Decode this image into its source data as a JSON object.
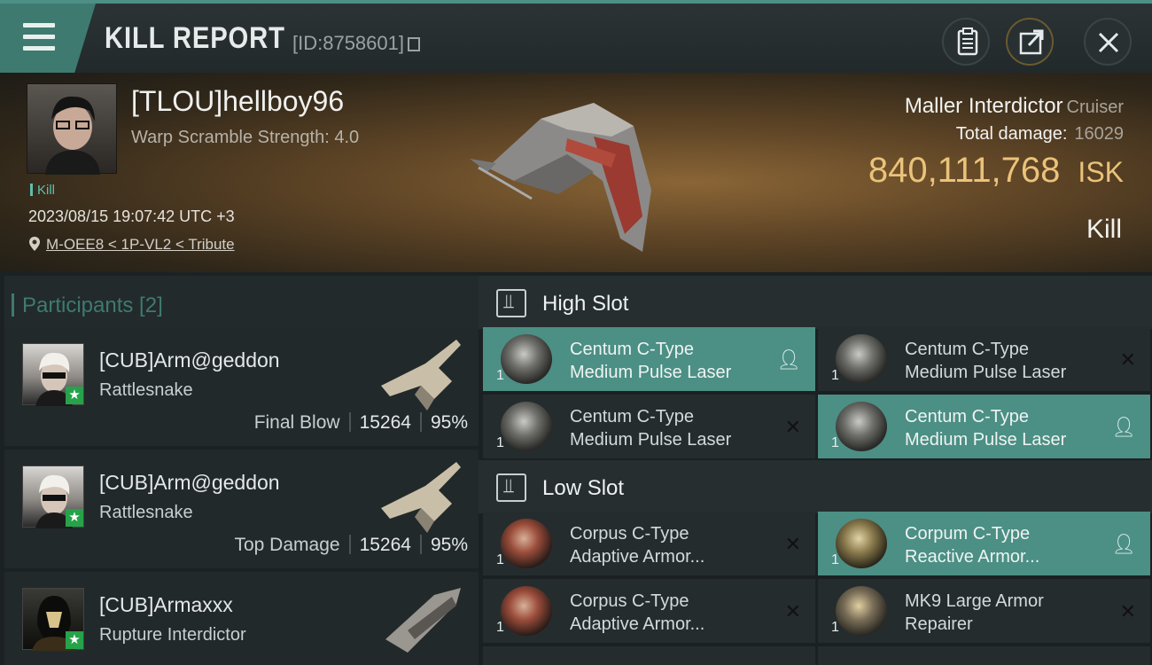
{
  "header": {
    "title": "KILL REPORT",
    "id_text": "[ID:8758601]"
  },
  "victim": {
    "name": "[TLOU]hellboy96",
    "warp_scramble": "Warp Scramble Strength: 4.0",
    "kill_tag": "Kill",
    "datetime": "2023/08/15 19:07:42 UTC +3",
    "location": "M-OEE8 < 1P-VL2 < Tribute",
    "ship_name": "Maller Interdictor",
    "ship_class": "Cruiser",
    "total_damage_label": "Total damage:",
    "total_damage": "16029",
    "isk_value": "840,111,768",
    "isk_unit": "ISK",
    "result": "Kill"
  },
  "participants": {
    "title": "Participants [2]",
    "rows": [
      {
        "name": "[CUB]Arm@geddon",
        "ship": "Rattlesnake",
        "role": "Final Blow",
        "damage": "15264",
        "percent": "95%"
      },
      {
        "name": "[CUB]Arm@geddon",
        "ship": "Rattlesnake",
        "role": "Top Damage",
        "damage": "15264",
        "percent": "95%"
      },
      {
        "name": "[CUB]Armaxxx",
        "ship": "Rupture Interdictor",
        "role": "",
        "damage": "",
        "percent": ""
      }
    ]
  },
  "modules": {
    "high_slot_label": "High Slot",
    "low_slot_label": "Low Slot",
    "high": [
      {
        "line1": "Centum C-Type",
        "line2": "Medium Pulse Laser",
        "qty": "1",
        "status": "dropped"
      },
      {
        "line1": "Centum C-Type",
        "line2": "Medium Pulse Laser",
        "qty": "1",
        "status": "destroyed"
      },
      {
        "line1": "Centum C-Type",
        "line2": "Medium Pulse Laser",
        "qty": "1",
        "status": "destroyed"
      },
      {
        "line1": "Centum C-Type",
        "line2": "Medium Pulse Laser",
        "qty": "1",
        "status": "dropped"
      }
    ],
    "low": [
      {
        "line1": "Corpus C-Type",
        "line2": "Adaptive Armor...",
        "qty": "1",
        "status": "destroyed"
      },
      {
        "line1": "Corpum C-Type",
        "line2": "Reactive Armor...",
        "qty": "1",
        "status": "dropped"
      },
      {
        "line1": "Corpus C-Type",
        "line2": "Adaptive Armor...",
        "qty": "1",
        "status": "destroyed"
      },
      {
        "line1": "MK9 Large Armor",
        "line2": "Repairer",
        "qty": "1",
        "status": "destroyed"
      }
    ]
  },
  "colors": {
    "accent": "#4c8f84",
    "isk": "#eac37a",
    "corp_star": "#26a24a"
  },
  "icons": {
    "menu": "hamburger-icon",
    "clipboard": "clipboard-icon",
    "share": "share-icon",
    "close": "close-icon",
    "location": "map-pin-icon",
    "dropped": "person-icon",
    "destroyed": "x-icon"
  }
}
